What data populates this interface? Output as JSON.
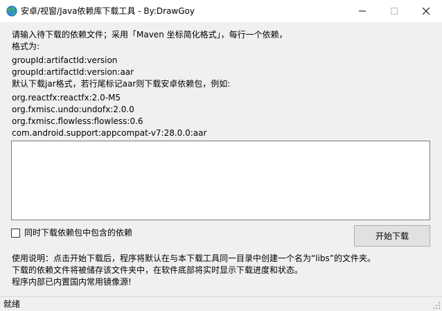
{
  "window": {
    "title": "安卓/视窗/Java依赖库下载工具 - By:DrawGoy",
    "icon": "globe-icon",
    "buttons": [
      "minimize-icon",
      "maximize-icon",
      "close-icon"
    ]
  },
  "instructions": [
    "请输入待下载的依赖文件；采用「Maven 坐标简化格式」，每行一个依赖，",
    "格式为:",
    "groupId:artifactId:version",
    "groupId:artifactId:version:aar",
    "默认下载jar格式，若行尾标记aar则下载安卓依赖包，例如:",
    "org.reactfx:reactfx:2.0-M5",
    "org.fxmisc.undo:undofx:2.0.0",
    "org.fxmisc.flowless:flowless:0.6",
    "com.android.support:appcompat-v7:28.0.0:aar"
  ],
  "dependencies_input": {
    "value": "",
    "placeholder": ""
  },
  "include_transitive": {
    "label": "同时下载依赖包中包含的依赖",
    "checked": false
  },
  "start_button": {
    "label": "开始下载"
  },
  "usage": [
    "使用说明：点击开始下载后，程序将默认在与本下载工具同一目录中创建一个名为“libs”的文件夹。",
    "下载的依赖文件将被储存该文件夹中，在软件底部将实时显示下载进度和状态。",
    "程序内部已内置国内常用镜像源!"
  ],
  "status": {
    "text": "就绪"
  },
  "colors": {
    "title_bg": "#ffffff",
    "client_bg": "#f0f0f0",
    "button_bg": "#e1e1e1",
    "input_border": "#7a7a7a"
  }
}
